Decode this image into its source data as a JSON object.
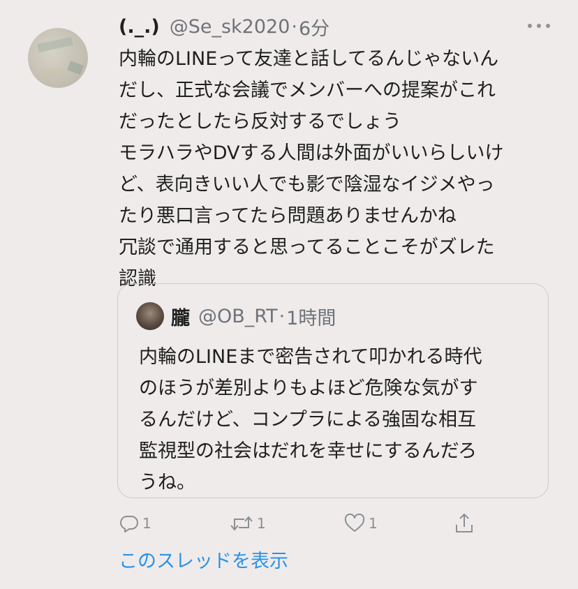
{
  "tweet": {
    "display_name": "(._.)",
    "handle": "@Se_sk2020",
    "separator": "·",
    "time": "6分",
    "lines": [
      "内輪のLINEって友達と話してるんじゃないん",
      "だし、正式な会議でメンバーへの提案がこれ",
      "だったとしたら反対するでしょう",
      "モラハラやDVする人間は外面がいいらしいけ",
      "ど、表向きいい人でも影で陰湿なイジメやっ",
      "たり悪口言ってたら問題ありませんかね",
      "冗談で通用すると思ってることこそがズレた",
      "認識"
    ]
  },
  "quote": {
    "display_name": "朧",
    "handle": "@OB_RT",
    "separator": "·",
    "time": "1時間",
    "lines": [
      "内輪のLINEまで密告されて叩かれる時代",
      "のほうが差別よりもよほど危険な気がす",
      "るんだけど、コンプラによる強固な相互",
      "監視型の社会はだれを幸せにするんだろ",
      "うね。"
    ]
  },
  "actions": {
    "reply_count": "1",
    "retweet_count": "1",
    "like_count": "1",
    "icons": [
      "reply-icon",
      "retweet-icon",
      "like-icon",
      "share-icon"
    ]
  },
  "show_thread": "このスレッドを表示",
  "colors": {
    "background": "#efebeb",
    "link": "#2a93e6",
    "muted": "#6e7378"
  }
}
